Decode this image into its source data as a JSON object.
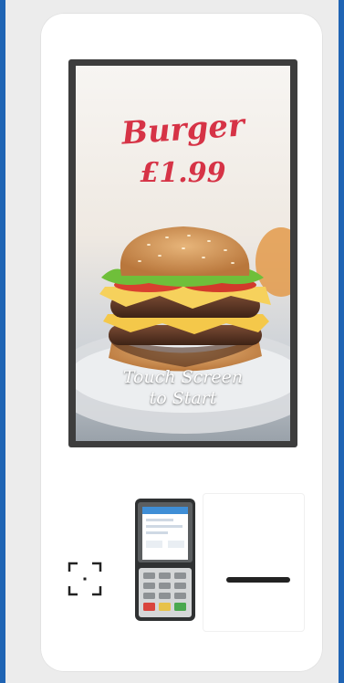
{
  "kiosk": {
    "screen": {
      "promo_name": "Burger",
      "promo_price": "£1.99",
      "cta_line1": "Touch Screen",
      "cta_line2": "to Start"
    },
    "peripherals": {
      "scanner_icon": "barcode-scanner-icon",
      "terminal_icon": "card-payment-terminal-icon",
      "receipt_slot": "receipt-printer-slot"
    }
  },
  "colors": {
    "background": "#1f64b4",
    "kiosk_body": "#ffffff",
    "bezel": "#3d3d3d",
    "accent_red": "#d63346"
  }
}
